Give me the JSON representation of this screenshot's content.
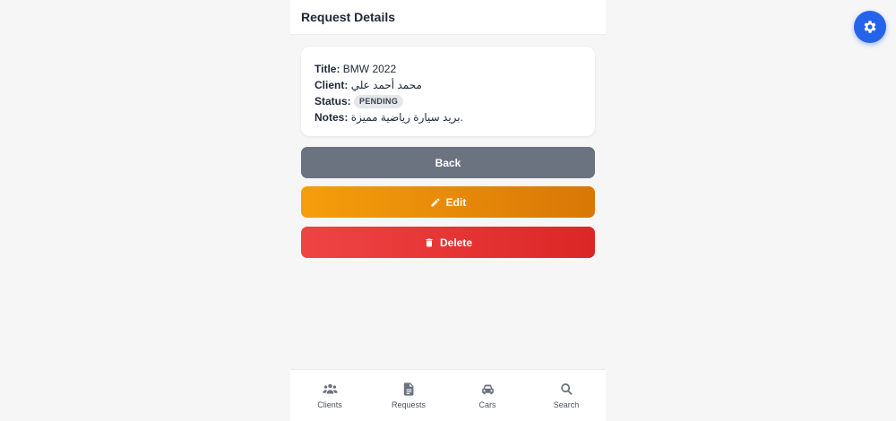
{
  "header": {
    "title": "Request Details"
  },
  "details": {
    "title_label": "Title:",
    "title_value": "BMW 2022",
    "client_label": "Client:",
    "client_value": "محمد أحمد علي",
    "status_label": "Status:",
    "status_value": "PENDING",
    "notes_label": "Notes:",
    "notes_value": "بريد سيارة رياضية مميزة."
  },
  "buttons": {
    "back": "Back",
    "edit": "Edit",
    "delete": "Delete"
  },
  "nav": {
    "items": [
      {
        "label": "Clients",
        "icon": "users-icon"
      },
      {
        "label": "Requests",
        "icon": "document-icon"
      },
      {
        "label": "Cars",
        "icon": "car-icon"
      },
      {
        "label": "Search",
        "icon": "search-icon"
      }
    ]
  },
  "colors": {
    "accent": "#2563eb",
    "back": "#6b7280",
    "edit": "#f59e0b",
    "delete": "#ef4444"
  }
}
